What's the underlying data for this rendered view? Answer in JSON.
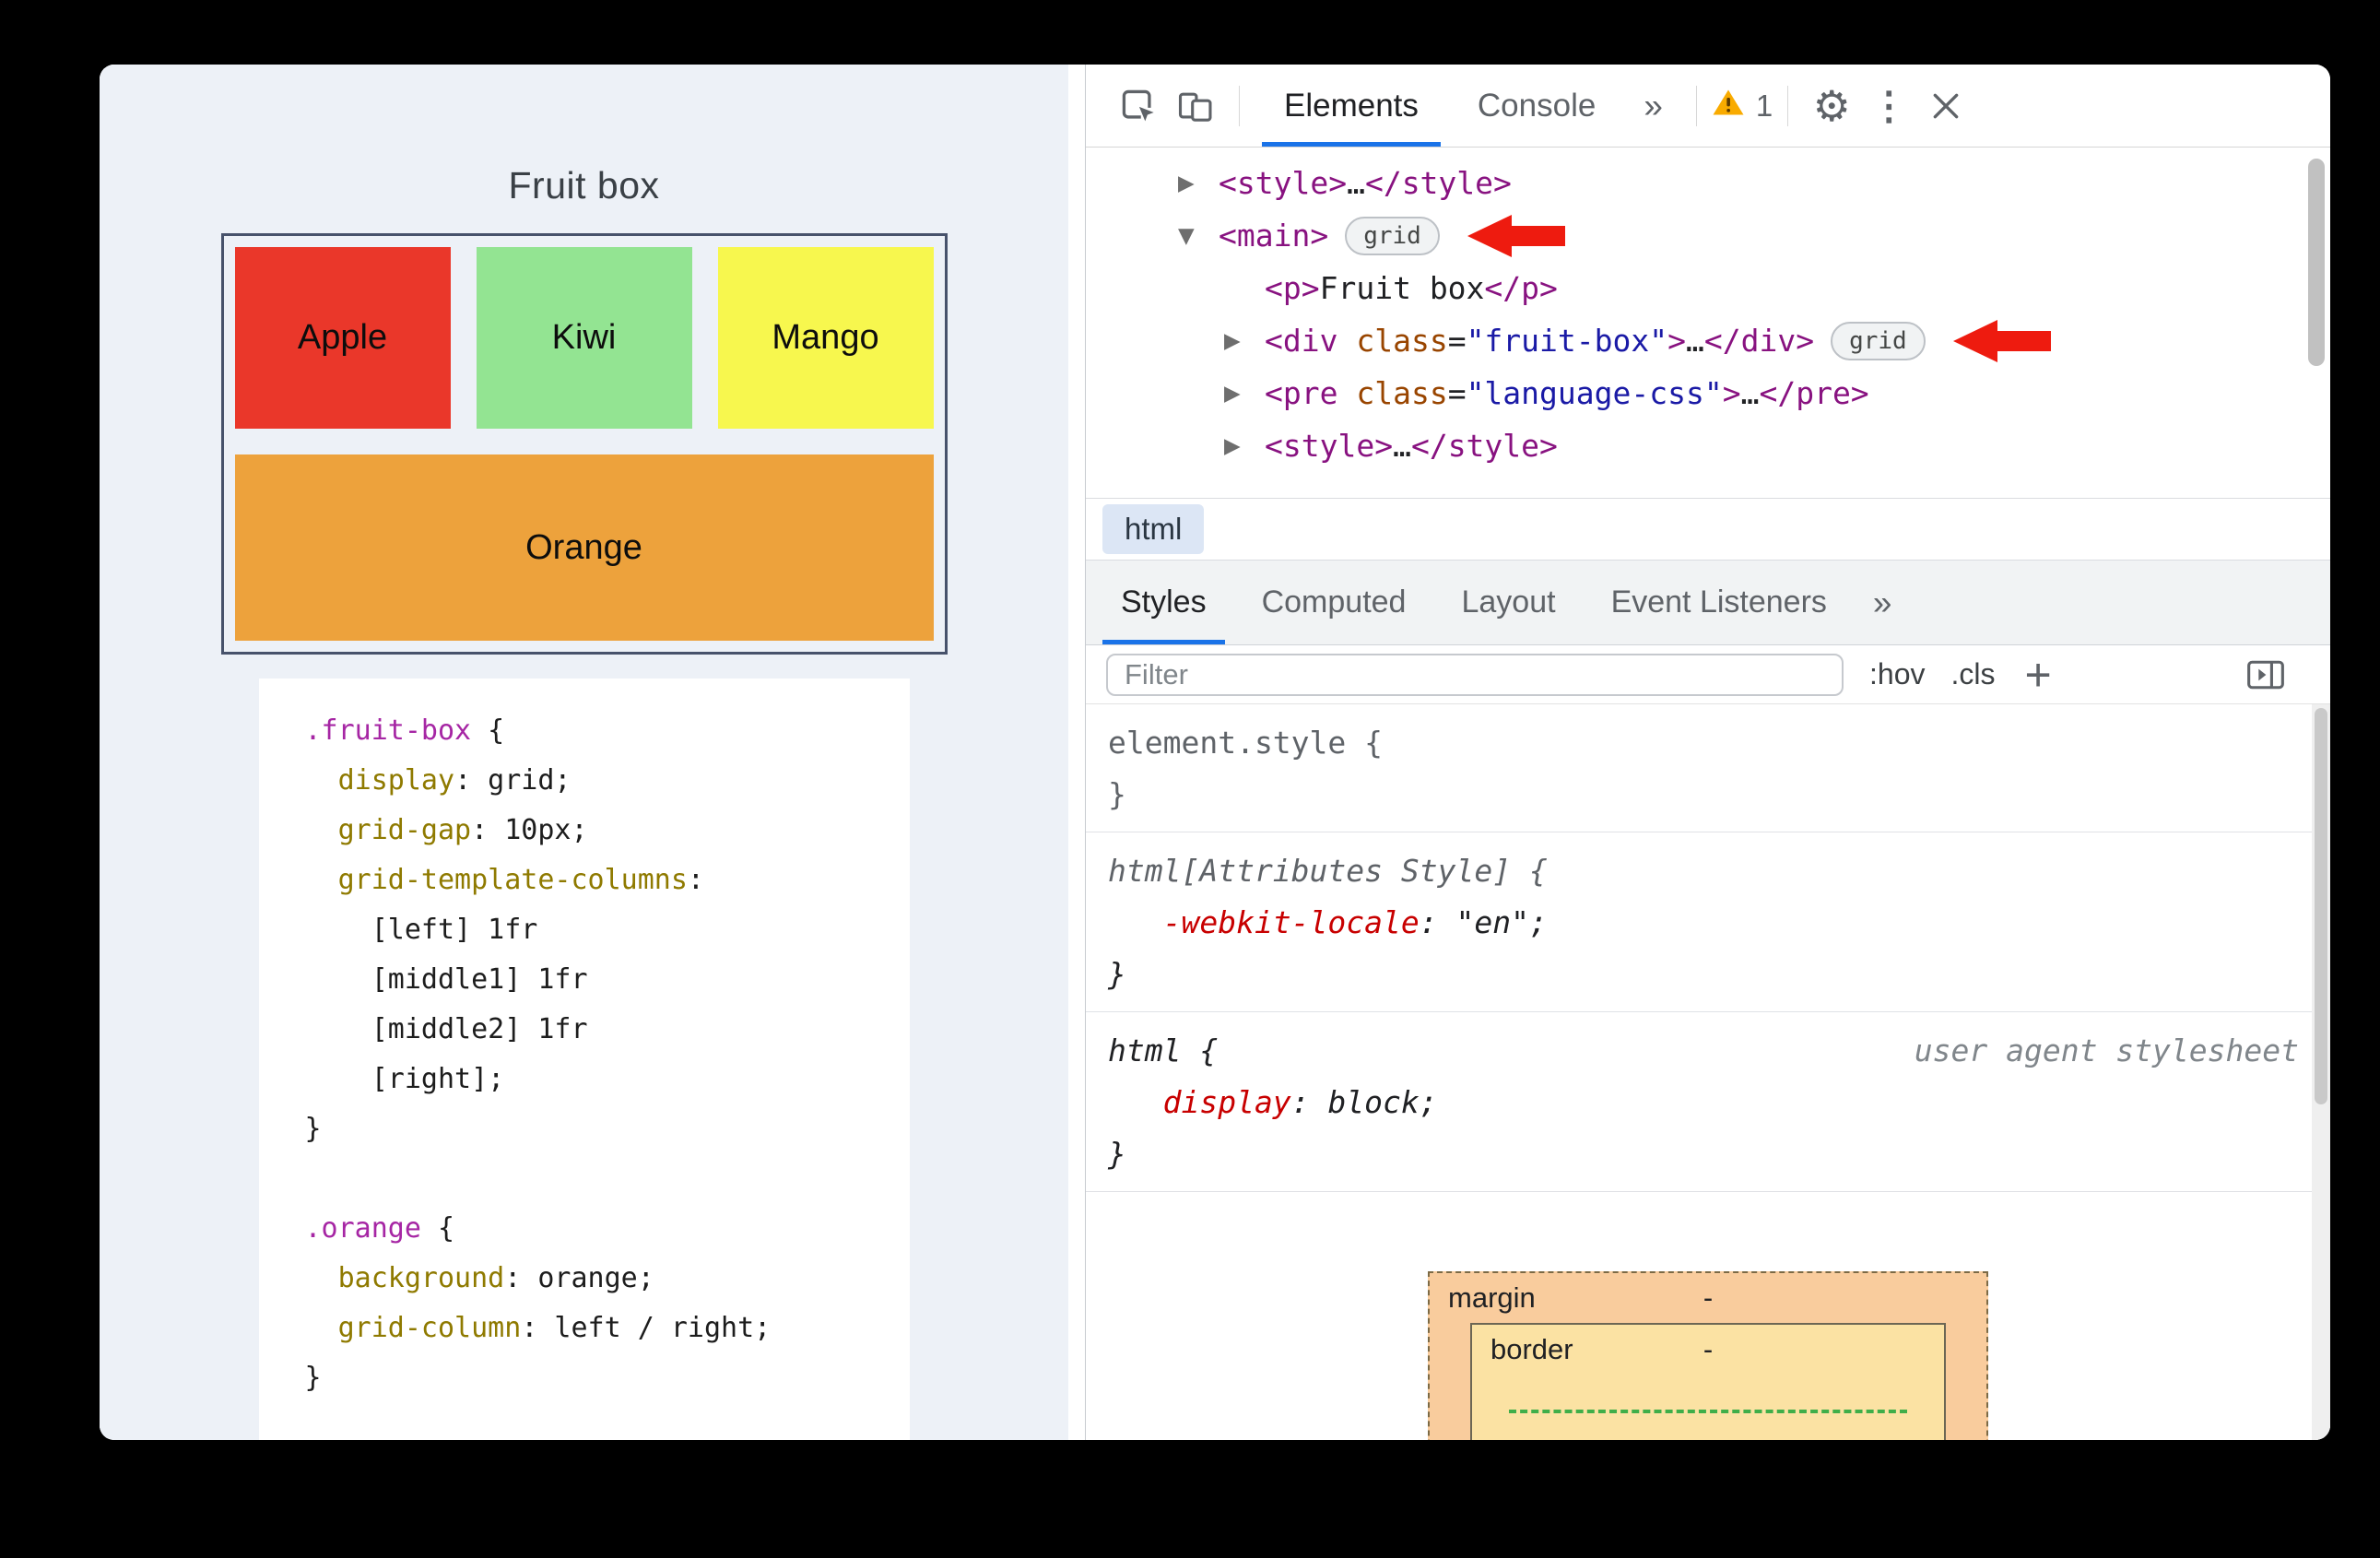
{
  "page": {
    "title": "Fruit box",
    "fruits": [
      {
        "label": "Apple",
        "color": "#ea372a",
        "span": 1
      },
      {
        "label": "Kiwi",
        "color": "#93e492",
        "span": 1
      },
      {
        "label": "Mango",
        "color": "#f7f74e",
        "span": 1
      },
      {
        "label": "Orange",
        "color": "#eda23c",
        "span": 3
      }
    ],
    "css_code": [
      [
        {
          "t": ".fruit-box",
          "c": "sel"
        },
        {
          "t": " {",
          "c": "pln"
        }
      ],
      [
        {
          "t": "  ",
          "c": "pln"
        },
        {
          "t": "display",
          "c": "prop"
        },
        {
          "t": ": grid;",
          "c": "pln"
        }
      ],
      [
        {
          "t": "  ",
          "c": "pln"
        },
        {
          "t": "grid-gap",
          "c": "prop"
        },
        {
          "t": ": 10px;",
          "c": "pln"
        }
      ],
      [
        {
          "t": "  ",
          "c": "pln"
        },
        {
          "t": "grid-template-columns",
          "c": "prop"
        },
        {
          "t": ":",
          "c": "pln"
        }
      ],
      [
        {
          "t": "    [left] 1fr",
          "c": "pln"
        }
      ],
      [
        {
          "t": "    [middle1] 1fr",
          "c": "pln"
        }
      ],
      [
        {
          "t": "    [middle2] 1fr",
          "c": "pln"
        }
      ],
      [
        {
          "t": "    [right];",
          "c": "pln"
        }
      ],
      [
        {
          "t": "}",
          "c": "pln"
        }
      ],
      [
        {
          "t": " ",
          "c": "pln"
        }
      ],
      [
        {
          "t": ".orange",
          "c": "sel"
        },
        {
          "t": " {",
          "c": "pln"
        }
      ],
      [
        {
          "t": "  ",
          "c": "pln"
        },
        {
          "t": "background",
          "c": "prop"
        },
        {
          "t": ": orange;",
          "c": "pln"
        }
      ],
      [
        {
          "t": "  ",
          "c": "pln"
        },
        {
          "t": "grid-column",
          "c": "prop"
        },
        {
          "t": ": left / right;",
          "c": "pln"
        }
      ],
      [
        {
          "t": "}",
          "c": "pln"
        }
      ]
    ]
  },
  "devtools": {
    "toolbar": {
      "tabs": [
        {
          "label": "Elements",
          "active": true
        },
        {
          "label": "Console",
          "active": false
        }
      ],
      "overflow": "»",
      "warning_count": "1"
    },
    "dom": [
      {
        "indent": 0,
        "arrow": "right",
        "badge": null,
        "pointer": false,
        "tokens": [
          {
            "t": "<style>",
            "c": "tag"
          },
          {
            "t": "…",
            "c": "dark"
          },
          {
            "t": "</style>",
            "c": "tag"
          }
        ]
      },
      {
        "indent": 0,
        "arrow": "down",
        "badge": "grid",
        "pointer": true,
        "tokens": [
          {
            "t": "<main>",
            "c": "tag"
          }
        ]
      },
      {
        "indent": 1,
        "arrow": "none",
        "badge": null,
        "pointer": false,
        "tokens": [
          {
            "t": "<p>",
            "c": "tag"
          },
          {
            "t": "Fruit box",
            "c": "dark"
          },
          {
            "t": "</p>",
            "c": "tag"
          }
        ]
      },
      {
        "indent": 1,
        "arrow": "right",
        "badge": "grid",
        "pointer": true,
        "tokens": [
          {
            "t": "<div ",
            "c": "tag"
          },
          {
            "t": "class",
            "c": "attr"
          },
          {
            "t": "=",
            "c": "dark"
          },
          {
            "t": "\"fruit-box\"",
            "c": "val"
          },
          {
            "t": ">",
            "c": "tag"
          },
          {
            "t": "…",
            "c": "dark"
          },
          {
            "t": "</div>",
            "c": "tag"
          }
        ]
      },
      {
        "indent": 1,
        "arrow": "right",
        "badge": null,
        "pointer": false,
        "tokens": [
          {
            "t": "<pre ",
            "c": "tag"
          },
          {
            "t": "class",
            "c": "attr"
          },
          {
            "t": "=",
            "c": "dark"
          },
          {
            "t": "\"language-css\"",
            "c": "val"
          },
          {
            "t": ">",
            "c": "tag"
          },
          {
            "t": "…",
            "c": "dark"
          },
          {
            "t": "</pre>",
            "c": "tag"
          }
        ]
      },
      {
        "indent": 1,
        "arrow": "right",
        "badge": null,
        "pointer": false,
        "tokens": [
          {
            "t": "<style>",
            "c": "tag"
          },
          {
            "t": "…",
            "c": "dark"
          },
          {
            "t": "</style>",
            "c": "tag"
          }
        ]
      }
    ],
    "crumb": "html",
    "sidebar": {
      "tabs": [
        "Styles",
        "Computed",
        "Layout",
        "Event Listeners"
      ],
      "active_tab": "Styles",
      "overflow": "»"
    },
    "filter": {
      "placeholder": "Filter",
      "pseudo": ":hov",
      "classes": ".cls",
      "plus": "+"
    },
    "rules": [
      {
        "italic": false,
        "note": null,
        "lines": [
          [
            {
              "t": "element.style {",
              "c": "gray"
            }
          ],
          [
            {
              "t": "}",
              "c": "gray"
            }
          ]
        ]
      },
      {
        "italic": true,
        "note": null,
        "lines": [
          [
            {
              "t": "html[Attributes Style] {",
              "c": "gray"
            }
          ],
          [
            {
              "t": "   ",
              "c": "pln"
            },
            {
              "t": "-webkit-locale",
              "c": "cssprop"
            },
            {
              "t": ": ",
              "c": "dark"
            },
            {
              "t": "\"en\"",
              "c": "dark"
            },
            {
              "t": ";",
              "c": "dark"
            }
          ],
          [
            {
              "t": "}",
              "c": "dark"
            }
          ]
        ]
      },
      {
        "italic": true,
        "note": "user agent stylesheet",
        "lines": [
          [
            {
              "t": "html {",
              "c": "dark"
            }
          ],
          [
            {
              "t": "   ",
              "c": "pln"
            },
            {
              "t": "display",
              "c": "cssprop"
            },
            {
              "t": ": ",
              "c": "dark"
            },
            {
              "t": "block",
              "c": "dark"
            },
            {
              "t": ";",
              "c": "dark"
            }
          ],
          [
            {
              "t": "}",
              "c": "dark"
            }
          ]
        ]
      }
    ],
    "box_model": {
      "margin_label": "margin",
      "margin_value": "-",
      "border_label": "border",
      "border_value": "-"
    }
  },
  "colors": {
    "accent_blue": "#1a73e8",
    "warning_orange": "#f9ab00",
    "annotation_red": "#ee1b0f",
    "page_background": "#edf1f7",
    "apple": "#ea372a",
    "kiwi": "#93e492",
    "mango": "#f7f74e",
    "orange": "#eda23c",
    "devtools_tag_purple": "#881280",
    "devtools_attr_orange": "#994500",
    "devtools_value_blue": "#1a1aa6",
    "css_property_red": "#c80000"
  }
}
